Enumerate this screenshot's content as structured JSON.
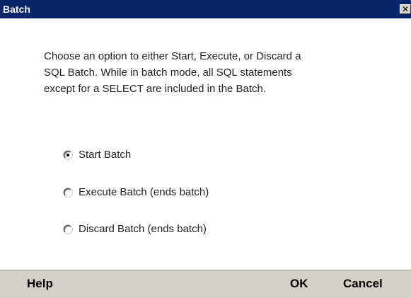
{
  "window": {
    "title": "Batch",
    "close_glyph": "✕"
  },
  "description": {
    "lines": [
      "Choose an option to either Start, Execute, or Discard a",
      "SQL Batch. While in batch mode, all SQL statements",
      "except for a SELECT are included in the Batch."
    ]
  },
  "options": [
    {
      "label": "Start Batch",
      "selected": true
    },
    {
      "label": "Execute Batch (ends batch)",
      "selected": false
    },
    {
      "label": "Discard Batch (ends batch)",
      "selected": false
    }
  ],
  "footer": {
    "help_label": "Help",
    "ok_label": "OK",
    "cancel_label": "Cancel"
  },
  "colors": {
    "titlebar": "#0a246a",
    "footer": "#d4d0c8"
  }
}
